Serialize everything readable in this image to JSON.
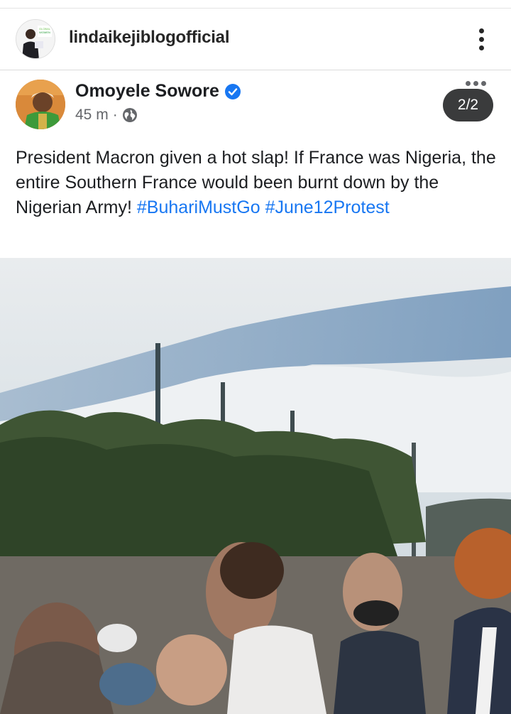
{
  "instagram": {
    "username": "lindaikejiblogofficial",
    "avatar_icon": "profile-photo",
    "more_icon": "vertical-dots-icon"
  },
  "post": {
    "author": "Omoyele Sowore",
    "verified_icon": "verified-check-icon",
    "time": "45 m",
    "separator": "·",
    "audience_icon": "globe-icon",
    "counter": "2/2",
    "text": "President Macron given a hot slap! If France was Nigeria, the entire Southern France would been burnt down by the Nigerian Army!",
    "hashtags": [
      "#BuhariMustGo",
      "#June12Protest"
    ],
    "link_color": "#1877f2",
    "media": "video-still"
  }
}
